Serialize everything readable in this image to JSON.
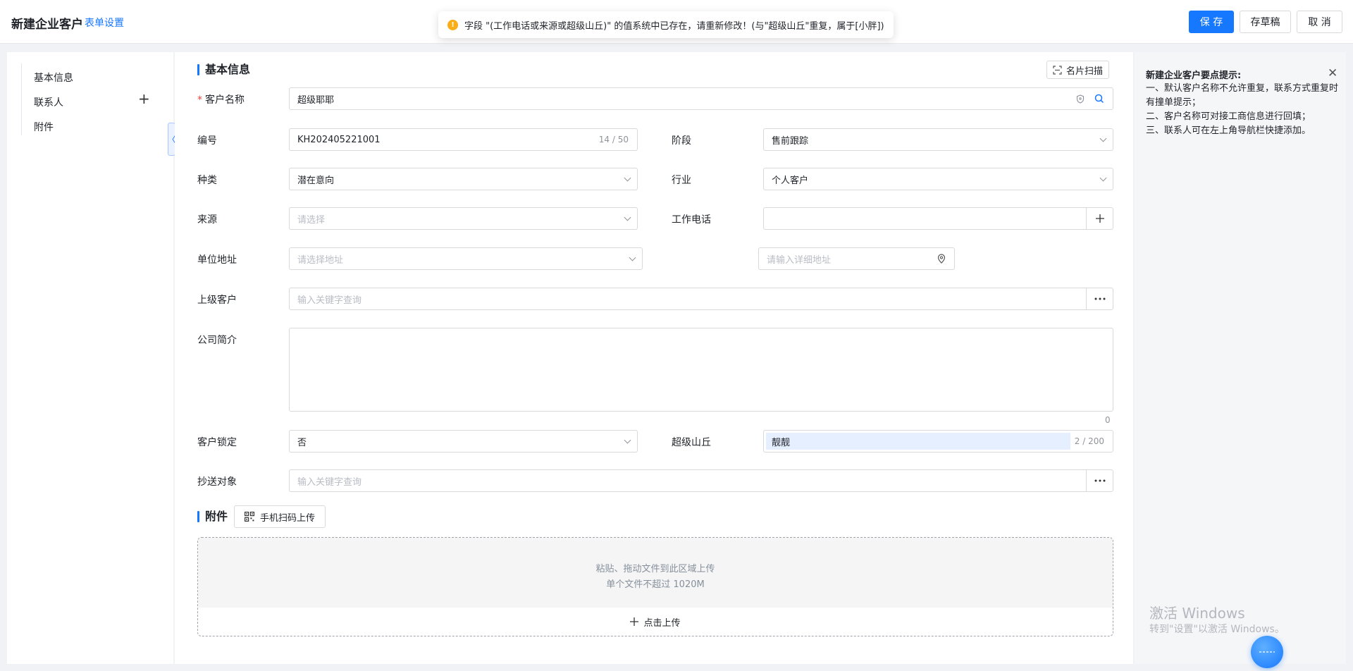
{
  "header": {
    "title": "新建企业客户",
    "form_settings": "表单设置",
    "save": "保 存",
    "draft": "存草稿",
    "cancel": "取 消"
  },
  "toast": {
    "message": "字段 \"(工作电话或来源或超级山丘)\" 的值系统中已存在，请重新修改！(与\"超级山丘\"重复，属于[小胖])",
    "icon": "warning-icon"
  },
  "sidebar": {
    "items": [
      {
        "label": "基本信息"
      },
      {
        "label": "联系人"
      },
      {
        "label": "附件"
      }
    ],
    "add_icon": "+",
    "collapse_icon": "〈"
  },
  "basic": {
    "section_title": "基本信息",
    "scan_card": "名片扫描",
    "customer_name": {
      "label": "客户名称",
      "required_mark": "*",
      "value": "超级耶耶"
    },
    "code": {
      "label": "编号",
      "value": "KH202405221001",
      "counter": "14 / 50"
    },
    "stage": {
      "label": "阶段",
      "value": "售前跟踪"
    },
    "kind": {
      "label": "种类",
      "value": "潜在意向"
    },
    "industry": {
      "label": "行业",
      "value": "个人客户"
    },
    "source": {
      "label": "来源",
      "placeholder": "请选择"
    },
    "work_phone": {
      "label": "工作电话",
      "value": ""
    },
    "address": {
      "label": "单位地址",
      "placeholder": "请选择地址",
      "detail_placeholder": "请输入详细地址"
    },
    "parent_customer": {
      "label": "上级客户",
      "placeholder": "输入关键字查询"
    },
    "intro": {
      "label": "公司简介",
      "value": "",
      "counter": "0"
    },
    "locked": {
      "label": "客户锁定",
      "value": "否"
    },
    "super_hill": {
      "label": "超级山丘",
      "value": "靓靓",
      "counter": "2 / 200"
    },
    "cc": {
      "label": "抄送对象",
      "placeholder": "输入关键字查询"
    }
  },
  "attachments": {
    "section_title": "附件",
    "mobile_upload": "手机扫码上传",
    "hint1": "粘贴、拖动文件到此区域上传",
    "hint2": "单个文件不超过 1020M",
    "click_upload": "点击上传"
  },
  "tips": {
    "title": "新建企业客户要点提示:",
    "lines": [
      "一、默认客户名称不允许重复，联系方式重复时有撞单提示；",
      "二、客户名称可对接工商信息进行回填；",
      "三、联系人可在左上角导航栏快捷添加。"
    ]
  },
  "watermark": {
    "line1": "激活 Windows",
    "line2": "转到\"设置\"以激活 Windows。"
  },
  "colors": {
    "primary": "#1677ff",
    "required": "#f53f3f",
    "warning": "#faad14",
    "tips_bg": "#f5f6f8"
  }
}
